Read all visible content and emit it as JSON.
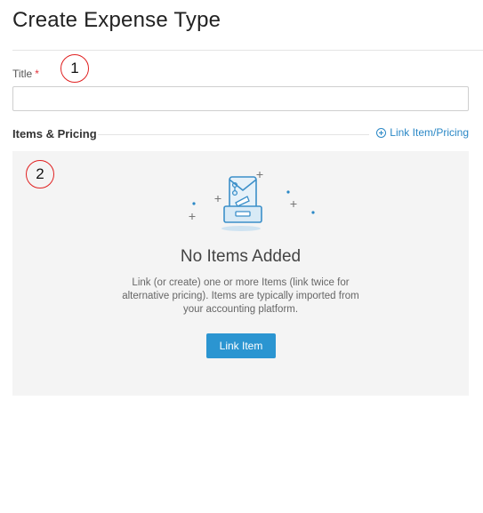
{
  "page": {
    "title": "Create Expense Type"
  },
  "form": {
    "title_label": "Title",
    "required_marker": "*",
    "title_value": ""
  },
  "callouts": [
    "1",
    "2"
  ],
  "items_section": {
    "header": "Items & Pricing",
    "link_label": "Link Item/Pricing"
  },
  "empty_state": {
    "title": "No Items Added",
    "description": "Link (or create) one or more Items (link twice for alternative pricing). Items are typically imported from your accounting platform.",
    "button_label": "Link Item"
  },
  "colors": {
    "accent": "#2b95d1",
    "link": "#2b88c6",
    "required": "#e3333b",
    "callout": "#e02020",
    "panel_bg": "#f4f4f4"
  },
  "icons": {
    "section_link": "plus-circle-icon",
    "illustration": "empty-tray-icon"
  }
}
